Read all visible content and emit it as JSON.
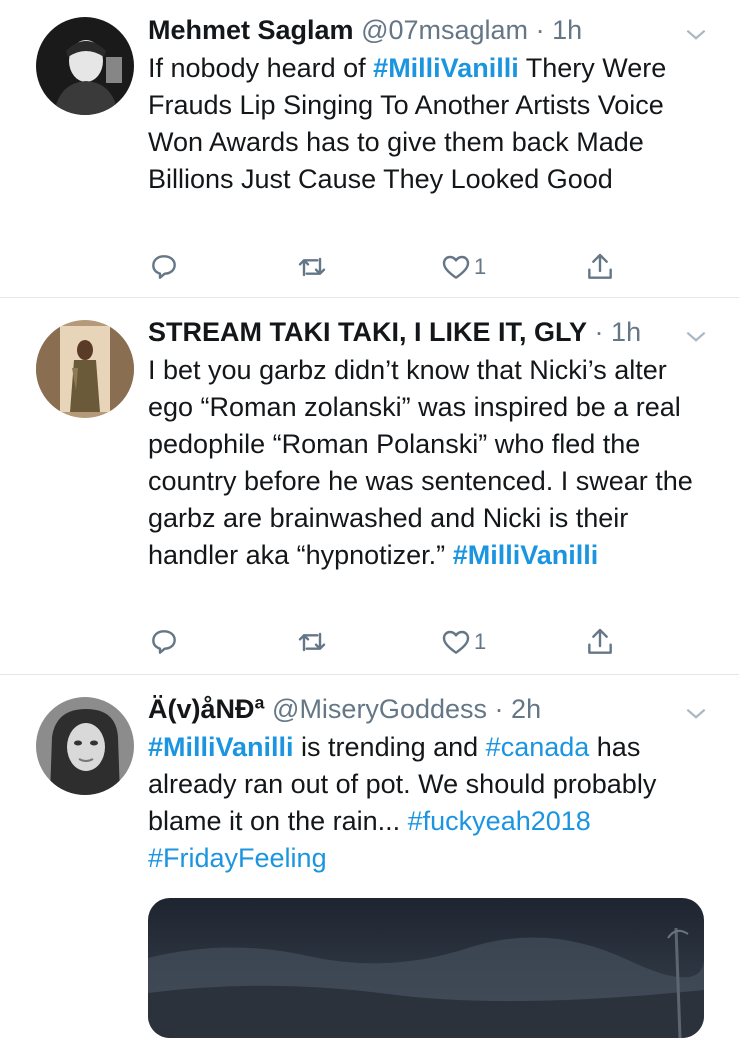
{
  "tweets": [
    {
      "name": "Mehmet Saglam",
      "handle": "@07msaglam",
      "dot": "·",
      "time": "1h",
      "body": [
        {
          "text": "If nobody heard of "
        },
        {
          "text": "#MilliVanilli",
          "tag": true,
          "bold": true
        },
        {
          "text": " Thery Were Frauds Lip Singing To Another Artists Voice Won Awards has to give them back Made Billions Just Cause They Looked Good"
        }
      ],
      "like_count": "1"
    },
    {
      "name": "STREAM TAKI TAKI, I LIKE IT, GLY",
      "handle": "",
      "dot": "·",
      "time": "1h",
      "body": [
        {
          "text": "I bet you garbz didn’t know that Nicki’s alter ego “Roman zolanski” was inspired be a real pedophile “Roman Polanski” who fled the country before he was sentenced. I swear the garbz are brainwashed and Nicki is their handler aka “hypnotizer.” "
        },
        {
          "text": "#MilliVanilli",
          "tag": true,
          "bold": true
        }
      ],
      "like_count": "1"
    },
    {
      "name": "Ä(v)åNÐª",
      "handle": "@MiseryGoddess",
      "dot": "·",
      "time": "2h",
      "body": [
        {
          "text": "#MilliVanilli",
          "tag": true,
          "bold": true
        },
        {
          "text": " is trending and "
        },
        {
          "text": "#canada",
          "tag": true
        },
        {
          "text": " has already ran out of pot. We should probably blame it on the rain... "
        },
        {
          "text": "#fuckyeah2018",
          "tag": true
        },
        {
          "text": " "
        },
        {
          "text": "#FridayFeeling",
          "tag": true
        }
      ]
    }
  ],
  "icons": {
    "reply": "reply-icon",
    "retweet": "retweet-icon",
    "like": "heart-icon",
    "share": "share-icon",
    "caret": "chevron-down-icon"
  },
  "colors": {
    "link": "#1b95e0",
    "secondary": "#657786",
    "divider": "#e1e8ed"
  }
}
